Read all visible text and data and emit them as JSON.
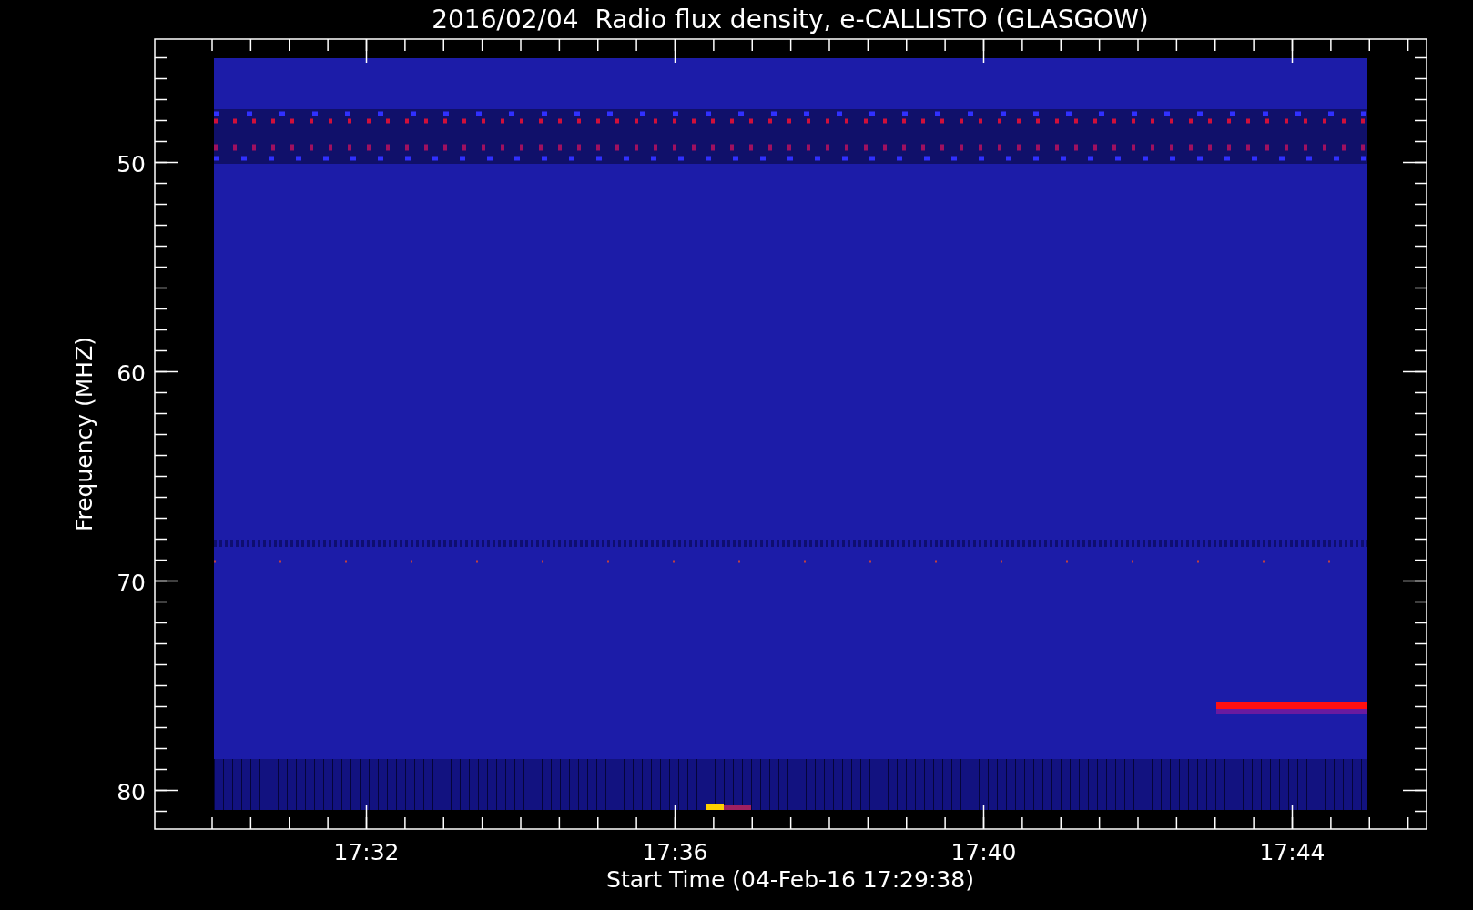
{
  "title": "2016/02/04  Radio flux density, e-CALLISTO (GLASGOW)",
  "y_axis": {
    "label": "Frequency (MHZ)",
    "ticks": [
      "50",
      "60",
      "70",
      "80"
    ]
  },
  "x_axis": {
    "label": "Start Time (04-Feb-16 17:29:38)",
    "ticks": [
      "17:32",
      "17:36",
      "17:40",
      "17:44"
    ]
  }
}
